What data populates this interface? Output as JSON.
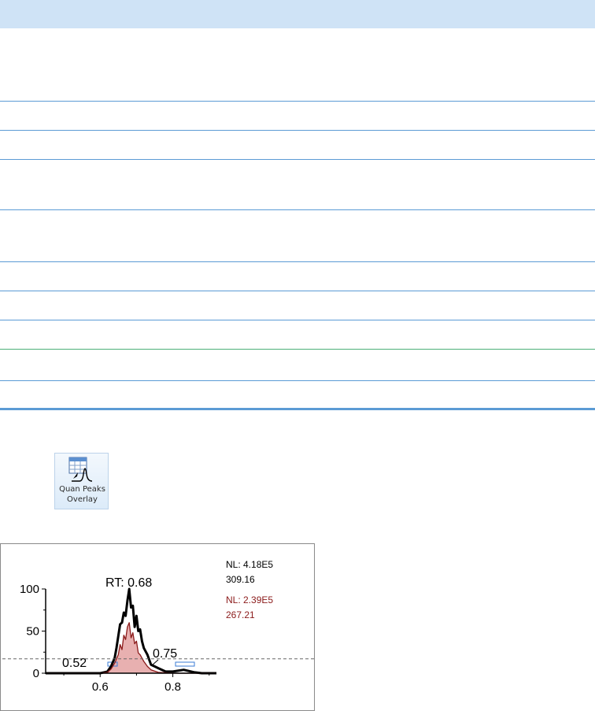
{
  "window": {
    "header_band_color": "#cfe3f6",
    "row_rule_color": "#5b9bd5"
  },
  "table": {
    "row_count": 10
  },
  "ribbon": {
    "quan_peaks_overlay_label": "Quan Peaks\nOverlay",
    "icon": "quan-peaks-overlay-icon"
  },
  "chart_data": {
    "type": "line",
    "annotations": {
      "rt_label": "RT: 0.68",
      "left_peak_label": "0.52",
      "right_peak_label": "0.75"
    },
    "legend": [
      {
        "nl": "NL: 4.18E5",
        "mass": "309.16",
        "color": "#000000"
      },
      {
        "nl": "NL: 2.39E5",
        "mass": "267.21",
        "color": "#8b1a1a"
      }
    ],
    "xticks": [
      "0.6",
      "0.8"
    ],
    "yticks": [
      "0",
      "50",
      "100"
    ],
    "xlim": [
      0.45,
      0.92
    ],
    "ylim": [
      0,
      100
    ],
    "threshold": 17,
    "series": [
      {
        "color": "#000000",
        "x": [
          0.45,
          0.55,
          0.6,
          0.62,
          0.63,
          0.64,
          0.645,
          0.65,
          0.655,
          0.66,
          0.665,
          0.67,
          0.675,
          0.68,
          0.685,
          0.69,
          0.695,
          0.7,
          0.705,
          0.71,
          0.715,
          0.72,
          0.73,
          0.74,
          0.75,
          0.76,
          0.78,
          0.8,
          0.83,
          0.86,
          0.88,
          0.92
        ],
        "y": [
          0,
          0,
          0,
          2,
          8,
          18,
          30,
          44,
          58,
          60,
          72,
          68,
          86,
          100,
          78,
          80,
          55,
          68,
          50,
          52,
          38,
          30,
          22,
          10,
          8,
          6,
          2,
          2,
          4,
          1,
          0,
          0
        ]
      },
      {
        "color": "#8b1a1a",
        "fill": "#e8b0b0",
        "x": [
          0.45,
          0.6,
          0.62,
          0.63,
          0.64,
          0.65,
          0.655,
          0.66,
          0.665,
          0.67,
          0.675,
          0.68,
          0.685,
          0.69,
          0.695,
          0.7,
          0.705,
          0.71,
          0.72,
          0.73,
          0.74,
          0.76,
          0.8,
          0.92
        ],
        "y": [
          0,
          0,
          1,
          5,
          12,
          22,
          34,
          28,
          45,
          40,
          55,
          60,
          42,
          48,
          35,
          38,
          24,
          22,
          14,
          8,
          4,
          1,
          0,
          0
        ]
      }
    ]
  }
}
